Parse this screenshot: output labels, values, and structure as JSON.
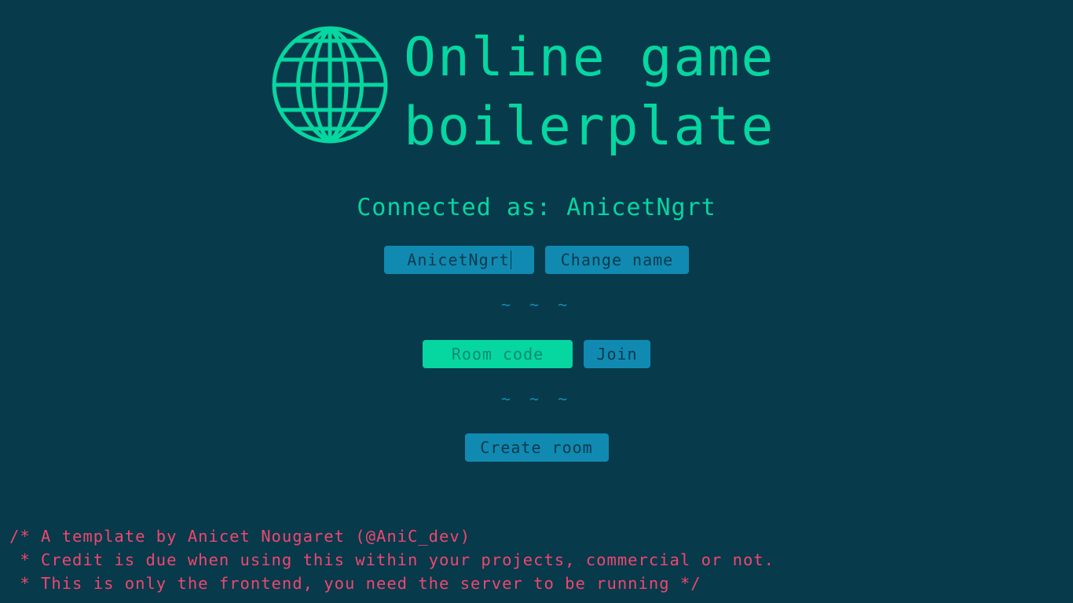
{
  "header": {
    "title_line1": "Online game",
    "title_line2": "boilerplate",
    "logo_icon": "globe-icon"
  },
  "status": {
    "connected_text": "Connected as: AnicetNgrt"
  },
  "name_form": {
    "name_value": "AnicetNgrt",
    "change_button_label": "Change name"
  },
  "separator": "~ ~ ~",
  "join_form": {
    "room_placeholder": "Room code",
    "join_button_label": "Join"
  },
  "create_form": {
    "create_button_label": "Create room"
  },
  "footer": {
    "line1": "/* A template by Anicet Nougaret (@AniC_dev)",
    "line2": " * Credit is due when using this within your projects, commercial or not.",
    "line3": " * This is only the frontend, you need the server to be running */"
  },
  "colors": {
    "background": "#073a4b",
    "accent_green": "#06d6a0",
    "accent_blue": "#118ab2",
    "comment_pink": "#ef476f"
  }
}
